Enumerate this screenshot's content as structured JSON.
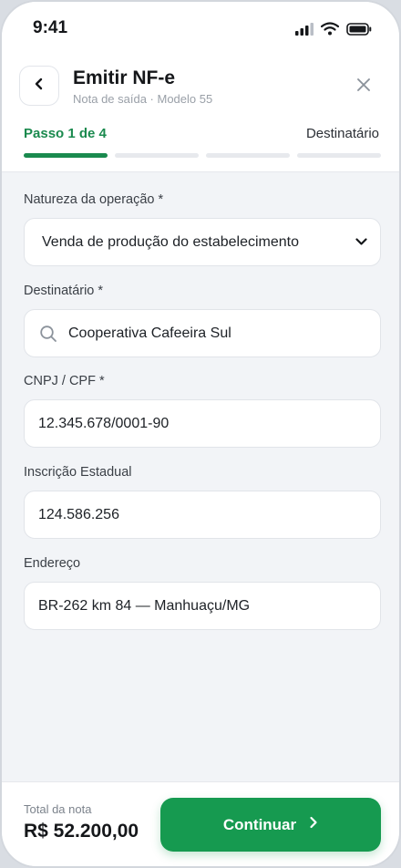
{
  "status_bar": {
    "time": "9:41"
  },
  "header": {
    "title": "Emitir NF-e",
    "subtitle": "Nota de saída · Modelo 55",
    "step_label": "Passo 1 de 4",
    "step_name": "Destinatário",
    "progress": {
      "current_step": 1,
      "total_steps": 4
    }
  },
  "form": {
    "natureza": {
      "label": "Natureza da operação *",
      "value": "Venda de produção do estabelecimento"
    },
    "destinatario": {
      "label": "Destinatário *",
      "value": "Cooperativa Cafeeira Sul"
    },
    "cnpj": {
      "label": "CNPJ / CPF *",
      "value": "12.345.678/0001-90"
    },
    "inscricao": {
      "label": "Inscrição Estadual",
      "value": "124.586.256"
    },
    "endereco": {
      "label": "Endereço",
      "value": "BR-262 km 84 — Manhuaçu/MG"
    }
  },
  "footer": {
    "total_label": "Total da nota",
    "total_value": "R$ 52.200,00",
    "continue_label": "Continuar"
  },
  "colors": {
    "accent": "#1a8a4e",
    "button": "#169a50",
    "background": "#f2f4f7"
  },
  "icons": [
    "signal-icon",
    "wifi-icon",
    "battery-icon",
    "back-arrow-icon",
    "close-icon",
    "chevron-down-icon",
    "search-icon",
    "chevron-right-icon"
  ]
}
